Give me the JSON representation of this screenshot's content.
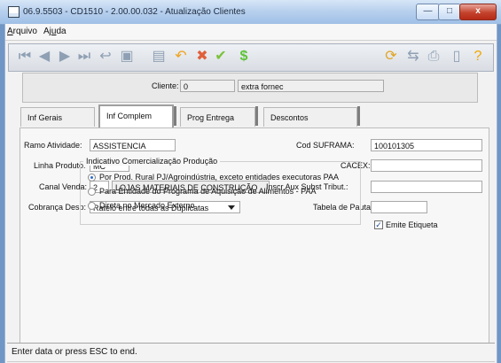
{
  "window": {
    "title": "06.9.5503 - CD1510 - 2.00.00.032 - Atualização Clientes",
    "controls": {
      "minimize": "—",
      "maximize": "□",
      "close": "x"
    }
  },
  "menu": {
    "items": [
      {
        "label": "Arquivo",
        "underline": "A",
        "rest": "rquivo"
      },
      {
        "label": "Ajuda",
        "before": "Aj",
        "underline": "u",
        "after": "da"
      }
    ]
  },
  "toolbar": {
    "left_icons": [
      "first-record-icon",
      "previous-record-icon",
      "next-record-icon",
      "last-record-icon",
      "return-icon",
      "save-icon",
      "attachment-icon",
      "undo-icon",
      "delete-icon",
      "confirm-icon",
      "money-icon"
    ],
    "right_icons": [
      "refresh-icon",
      "network-icon",
      "print-icon",
      "exit-icon",
      "help-icon"
    ]
  },
  "header": {
    "cliente_label": "Cliente:",
    "cliente_value": "0",
    "cliente_name": "extra fornec"
  },
  "tabs": [
    {
      "label": "Inf Gerais",
      "active": false
    },
    {
      "label": "Inf Complem",
      "active": true
    },
    {
      "label": "Prog Entrega",
      "active": false
    },
    {
      "label": "Descontos",
      "active": false
    }
  ],
  "form": {
    "ramo_atividade": {
      "label": "Ramo Atividade:",
      "value": "ASSISTENCIA"
    },
    "linha_produto": {
      "label": "Linha Produto:",
      "value": "MC"
    },
    "canal_venda": {
      "label": "Canal Venda:",
      "code": "2",
      "description": "LOJAS MATERIAIS DE CONSTRUÇÃO"
    },
    "cobranca_desp": {
      "label": "Cobrança Desp:",
      "value": "Rateio entre todas as Duplicatas"
    },
    "cod_suframa": {
      "label": "Cod SUFRAMA:",
      "value": "100101305"
    },
    "cacex": {
      "label": "CACEX:",
      "value": ""
    },
    "inscr_aux": {
      "label": "Inscr Aux Subst Tribut.:",
      "value": ""
    },
    "tabela_pauta": {
      "label": "Tabela de Pauta:",
      "value": ""
    },
    "emite_etiqueta": {
      "label": "Emite Etiqueta",
      "checked": true
    }
  },
  "group": {
    "title": "Indicativo Comercialização Produção",
    "options": [
      {
        "label": "Por Prod. Rural PJ/Agroindústria, exceto entidades executoras PAA",
        "selected": true
      },
      {
        "label": "Para Entidade do Programa de Aquisição de Alimentos - PAA",
        "selected": false
      },
      {
        "label": "Direta no Mercado Externo",
        "selected": false
      }
    ]
  },
  "status": {
    "text": "Enter data or press ESC to end."
  }
}
